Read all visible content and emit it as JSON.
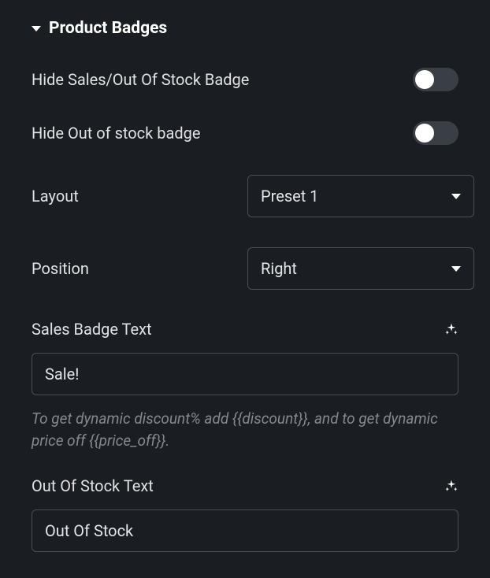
{
  "section": {
    "title": "Product Badges"
  },
  "fields": {
    "hideSales": {
      "label": "Hide Sales/Out Of Stock Badge",
      "on": false
    },
    "hideOos": {
      "label": "Hide Out of stock badge",
      "on": false
    },
    "layout": {
      "label": "Layout",
      "value": "Preset 1"
    },
    "position": {
      "label": "Position",
      "value": "Right"
    },
    "salesText": {
      "label": "Sales Badge Text",
      "value": "Sale!"
    },
    "salesHelp": "To get dynamic discount% add {{discount}}, and to get dynamic price off {{price_off}}.",
    "oosText": {
      "label": "Out Of Stock Text",
      "value": "Out Of Stock"
    }
  }
}
